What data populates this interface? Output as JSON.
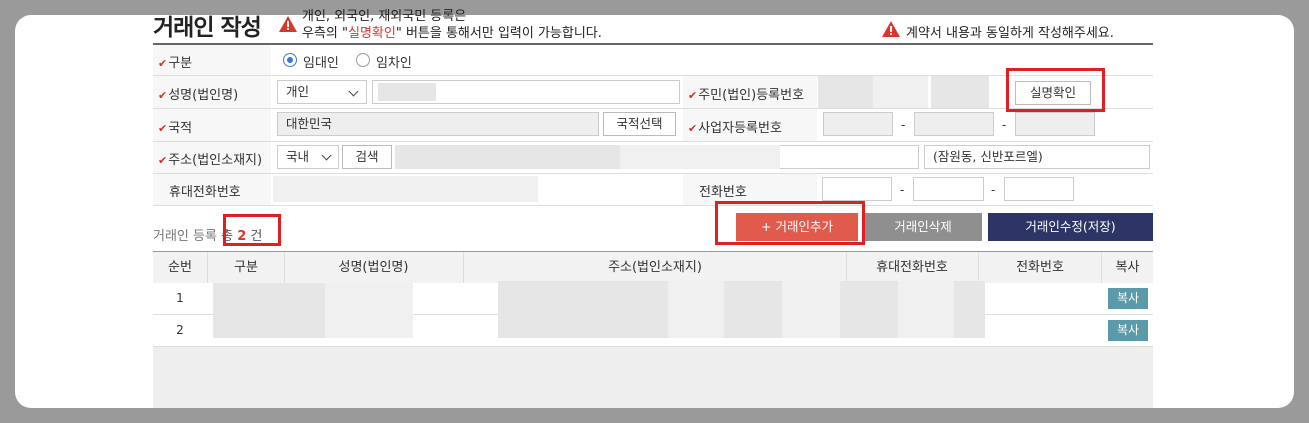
{
  "page": {
    "title": "거래인 작성",
    "notice_line1": "개인, 외국인, 재외국민 등록은",
    "notice_line2_pre": "우측의 \"",
    "notice_line2_red": "실명확인",
    "notice_line2_post": "\" 버튼을 통해서만 입력이 가능합니다.",
    "notice_right": "계약서 내용과 동일하게 작성해주세요."
  },
  "form": {
    "type_label": "구분",
    "type_options": [
      "임대인",
      "임차인"
    ],
    "type_selected": "임대인",
    "name_label": "성명(법인명)",
    "name_type_value": "개인",
    "id_label": "주민(법인)등록번호",
    "verify_button": "실명확인",
    "nationality_label": "국적",
    "nationality_value": "대한민국",
    "nationality_button": "국적선택",
    "bizno_label": "사업자등록번호",
    "dash": "-",
    "address_label": "주소(법인소재지)",
    "address_scope": "국내",
    "search_button": "검색",
    "address_extra": "(잠원동, 신반포르엘)",
    "mobile_label": "휴대전화번호",
    "phone_label": "전화번호"
  },
  "list": {
    "count_prefix": "거래인 등록",
    "count_total": "총",
    "count_value": "2",
    "count_suffix": "건",
    "add_button": "+ 거래인추가",
    "delete_button": "거래인삭제",
    "save_button": "거래인수정(저장)",
    "columns": [
      "순번",
      "구분",
      "성명(법인명)",
      "주소(법인소재지)",
      "휴대전화번호",
      "전화번호",
      "복사"
    ],
    "rows": [
      {
        "no": "1",
        "copy": "복사"
      },
      {
        "no": "2",
        "copy": "복사"
      }
    ]
  },
  "colors": {
    "red": "#e02020",
    "add_button": "#e05b4c",
    "delete_button": "#8f8f8f",
    "save_button": "#2c3566",
    "copy_button": "#5b9aa9"
  }
}
